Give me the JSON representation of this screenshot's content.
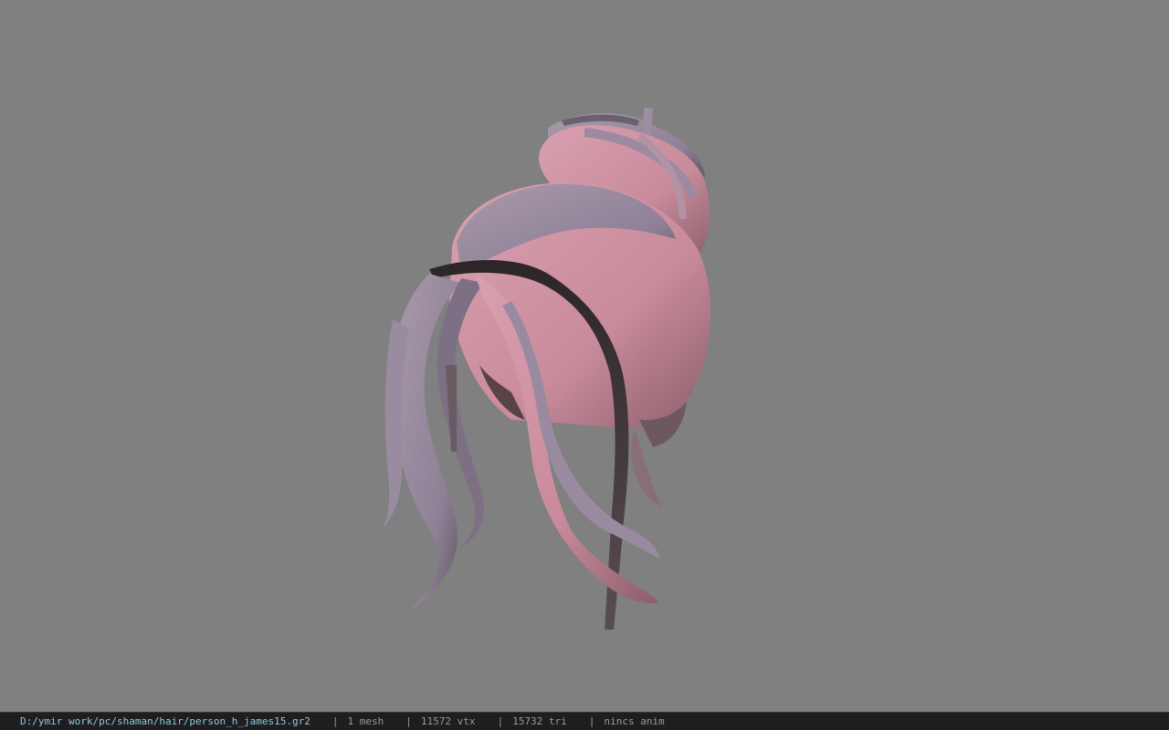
{
  "viewer": {
    "background_color": "#808080",
    "model": {
      "name": "hair-model",
      "colors": {
        "pink": "#c98b9c",
        "lavender": "#8e8096",
        "dark": "#3e3538",
        "highlight": "#a99aab"
      }
    }
  },
  "status_bar": {
    "file_path": "D:/ymir work/pc/shaman/hair/person_h_james15.gr2",
    "separator": "|",
    "mesh_count": "1 mesh",
    "vertex_count": "11572 vtx",
    "triangle_count": "15732 tri",
    "anim_status": "nincs anim"
  }
}
